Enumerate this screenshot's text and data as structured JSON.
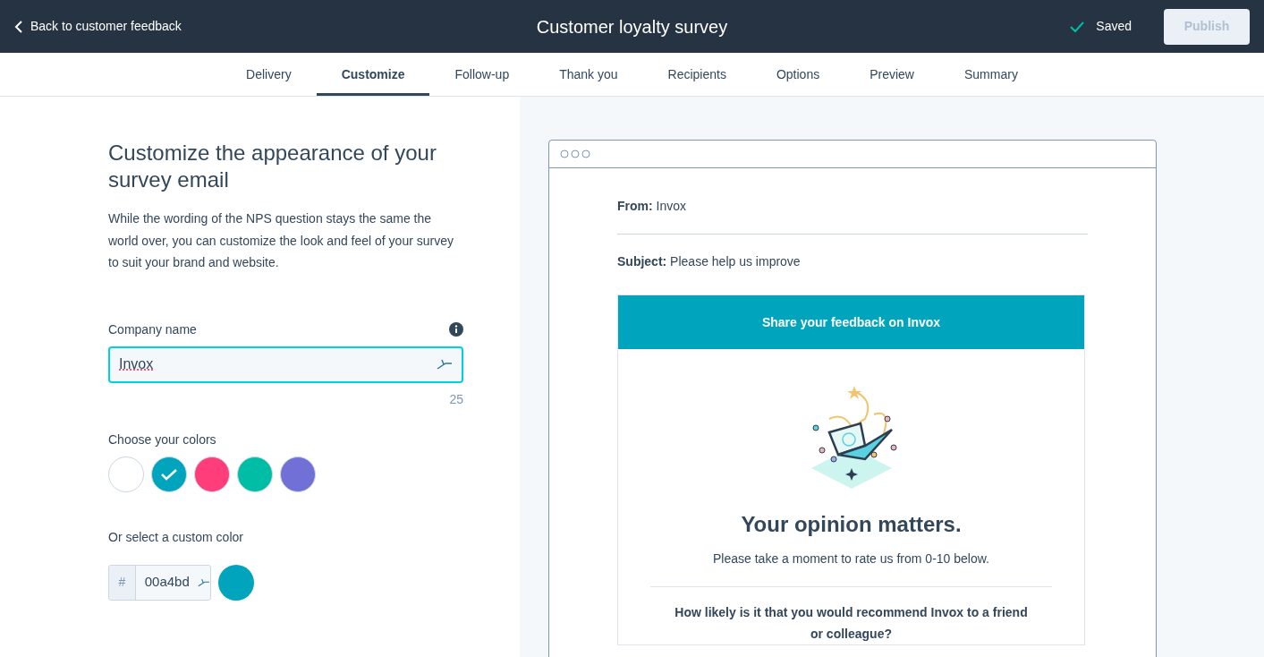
{
  "header": {
    "back_link": "Back to customer feedback",
    "title": "Customer loyalty survey",
    "status": "Saved",
    "publish_button": {
      "label": "Publish",
      "disabled": true
    }
  },
  "tabs": [
    {
      "label": "Delivery",
      "selected": false
    },
    {
      "label": "Customize",
      "selected": true
    },
    {
      "label": "Follow-up",
      "selected": false
    },
    {
      "label": "Thank you",
      "selected": false
    },
    {
      "label": "Recipients",
      "selected": false
    },
    {
      "label": "Options",
      "selected": false
    },
    {
      "label": "Preview",
      "selected": false
    },
    {
      "label": "Summary",
      "selected": false
    }
  ],
  "settings": {
    "heading": "Customize the appearance of your survey email",
    "description": "While the wording of the NPS question stays the same the world over, you can customize the look and feel of your survey to suit your brand and website.",
    "company_name": {
      "label": "Company name",
      "value": "Invox",
      "counter": "25"
    },
    "colors": {
      "label": "Choose your colors",
      "swatches": [
        {
          "color": "#ffffff",
          "selected": false
        },
        {
          "color": "#00a4bd",
          "selected": true
        },
        {
          "color": "#ff3d7a",
          "selected": false
        },
        {
          "color": "#00bda5",
          "selected": false
        },
        {
          "color": "#7070d6",
          "selected": false
        }
      ]
    },
    "custom_color": {
      "label": "Or select a custom color",
      "prefix": "#",
      "value": "00a4bd",
      "color": "#00a4bd"
    }
  },
  "preview": {
    "from": "**From:** Invox",
    "subject": "**Subject:** Please help us improve",
    "banner": "Share your feedback on Invox",
    "headline": "Your opinion matters.",
    "intro": "Please take a moment to rate us from 0-10 below.",
    "question": "How likely is it that you would recommend Invox to a friend or colleague?"
  }
}
